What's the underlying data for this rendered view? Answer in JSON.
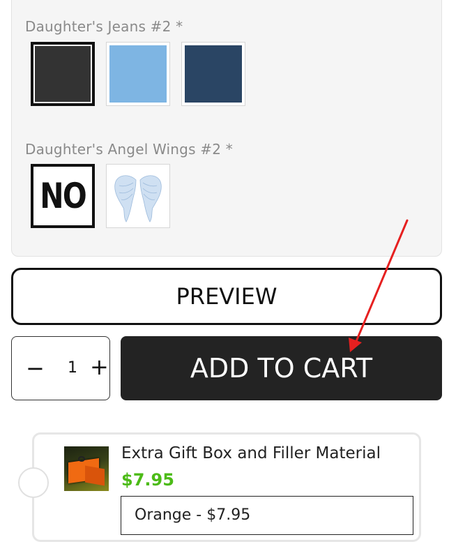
{
  "options": [
    {
      "label": "Daughter's Jeans #2 *",
      "swatches": [
        {
          "name": "black",
          "color": "#333333",
          "selected": true
        },
        {
          "name": "light-blue",
          "color": "#7eb5e3",
          "selected": false
        },
        {
          "name": "navy",
          "color": "#2a4564",
          "selected": false
        }
      ]
    },
    {
      "label": "Daughter's Angel Wings #2 *",
      "swatches": [
        {
          "name": "no",
          "text": "NO",
          "selected": true
        },
        {
          "name": "angel-wings",
          "icon": "angel-wings-icon",
          "selected": false
        }
      ]
    }
  ],
  "preview_button": "PREVIEW",
  "quantity": {
    "minus": "−",
    "value": "1",
    "plus": "+"
  },
  "add_to_cart": "ADD TO CART",
  "addon": {
    "title": "Extra Gift Box and Filler Material",
    "price": "$7.95",
    "price_color": "#4cbb17",
    "selected_option": "Orange - $7.95"
  },
  "annotation": {
    "type": "arrow",
    "color": "#e62020",
    "points_to": "add-to-cart-button"
  }
}
